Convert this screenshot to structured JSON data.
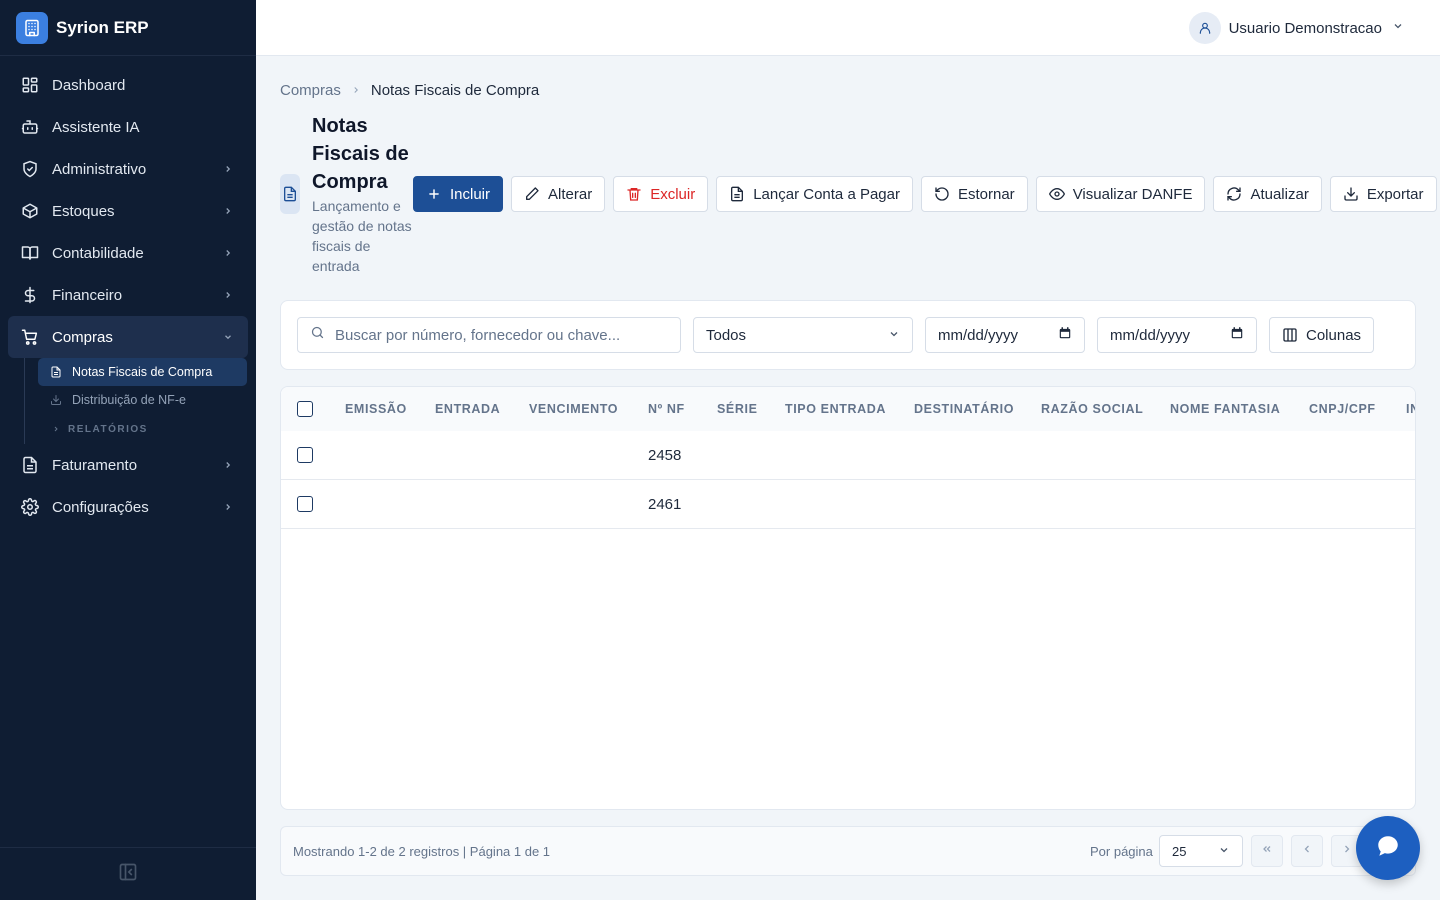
{
  "app": {
    "brand_name": "Syrion ERP",
    "brand_icon": "building-icon",
    "accent_color": "#1d4f96"
  },
  "sidebar": {
    "items": [
      {
        "label": "Dashboard",
        "icon": "dashboard-icon"
      },
      {
        "label": "Assistente IA",
        "icon": "bot-icon"
      },
      {
        "label": "Administrativo",
        "icon": "shield-icon"
      },
      {
        "label": "Estoques",
        "icon": "box-icon"
      },
      {
        "label": "Contabilidade",
        "icon": "book-icon"
      },
      {
        "label": "Financeiro",
        "icon": "dollar-icon"
      },
      {
        "label": "Compras",
        "icon": "cart-icon"
      },
      {
        "label": "Faturamento",
        "icon": "file-invoice-icon"
      },
      {
        "label": "Configurações",
        "icon": "gear-icon"
      }
    ],
    "compras_sub": {
      "items": [
        {
          "label": "Notas Fiscais de Compra",
          "icon": "document-icon"
        },
        {
          "label": "Distribuição de NF-e",
          "icon": "download-icon"
        }
      ],
      "section": "RELATÓRIOS"
    }
  },
  "topbar": {
    "user_name": "Usuario Demonstracao"
  },
  "breadcrumb": {
    "parent": "Compras",
    "current": "Notas Fiscais de Compra"
  },
  "page": {
    "title": "Notas Fiscais de Compra",
    "subtitle": "Lançamento e gestão de notas fiscais de entrada"
  },
  "toolbar": {
    "incluir": "Incluir",
    "alterar": "Alterar",
    "excluir": "Excluir",
    "lancar": "Lançar Conta a Pagar",
    "estornar": "Estornar",
    "visualizar": "Visualizar DANFE",
    "atualizar": "Atualizar",
    "exportar": "Exportar"
  },
  "filters": {
    "search_placeholder": "Buscar por número, fornecedor ou chave...",
    "status_value": "Todos",
    "date_from": "mm/dd/yyyy",
    "date_to": "mm/dd/yyyy",
    "columns_label": "Colunas"
  },
  "table": {
    "columns": [
      "EMISSÃO",
      "ENTRADA",
      "VENCIMENTO",
      "Nº NF",
      "SÉRIE",
      "TIPO ENTRADA",
      "DESTINATÁRIO",
      "RAZÃO SOCIAL",
      "NOME FANTASIA",
      "CNPJ/CPF",
      "IN"
    ],
    "rows": [
      {
        "nf": "2458"
      },
      {
        "nf": "2461"
      }
    ]
  },
  "pagination": {
    "info": "Mostrando 1-2 de 2 registros | Página 1 de 1",
    "per_page_label": "Por página",
    "per_page_value": "25"
  }
}
